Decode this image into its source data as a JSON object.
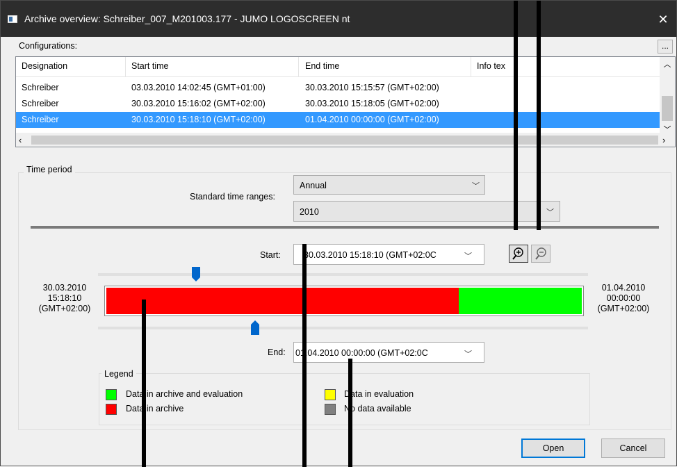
{
  "window": {
    "title": "Archive overview: Schreiber_007_M201003.177 - JUMO LOGOSCREEN nt",
    "close_glyph": "✕"
  },
  "configurations": {
    "label": "Configurations:",
    "more_button": "...",
    "columns": [
      "Designation",
      "Start time",
      "End time",
      "Info tex"
    ],
    "rows": [
      {
        "designation": "Schreiber",
        "start": "03.03.2010 14:02:45 (GMT+01:00)",
        "end": "30.03.2010 15:15:57 (GMT+02:00)",
        "info": ""
      },
      {
        "designation": "Schreiber",
        "start": "30.03.2010 15:16:02 (GMT+02:00)",
        "end": "30.03.2010 15:18:05 (GMT+02:00)",
        "info": ""
      },
      {
        "designation": "Schreiber",
        "start": "30.03.2010 15:18:10 (GMT+02:00)",
        "end": "01.04.2010 00:00:00 (GMT+02:00)",
        "info": ""
      }
    ],
    "selected_row": 2
  },
  "time_period": {
    "label": "Time period",
    "standard_label": "Standard time ranges:",
    "range_value": "Annual",
    "year_value": "2010",
    "start_label": "Start:",
    "start_value": "30.03.2010 15:18:10   (GMT+02:0C",
    "end_label": "End:",
    "end_value": "01.04.2010 00:00:00   (GMT+02:0C",
    "left_time": [
      "30.03.2010",
      "15:18:10",
      "(GMT+02:00)"
    ],
    "right_time": [
      "01.04.2010",
      "00:00:00",
      "(GMT+02:00)"
    ],
    "bar_segments": [
      {
        "status": "archive",
        "fraction": 0.741
      },
      {
        "status": "archive_and_evaluation",
        "fraction": 0.259
      }
    ],
    "start_slider_fraction": 0.19,
    "end_slider_fraction": 0.31
  },
  "legend": {
    "title": "Legend",
    "items": [
      {
        "label": "Data in archive and evaluation",
        "color": "#00ff00"
      },
      {
        "label": "Data in archive",
        "color": "#ff0000"
      },
      {
        "label": "Data in evaluation",
        "color": "#ffff00"
      },
      {
        "label": "No data available",
        "color": "#808080"
      }
    ]
  },
  "buttons": {
    "open": "Open",
    "cancel": "Cancel"
  },
  "icons": {
    "zoom_in": "zoom-in-icon",
    "zoom_out": "zoom-out-icon"
  },
  "colors": {
    "selection": "#3399ff",
    "archive": "#ff0000",
    "archive_and_evaluation": "#00ff00",
    "slider_thumb": "#0066cc",
    "default_button_border": "#0078d7"
  }
}
